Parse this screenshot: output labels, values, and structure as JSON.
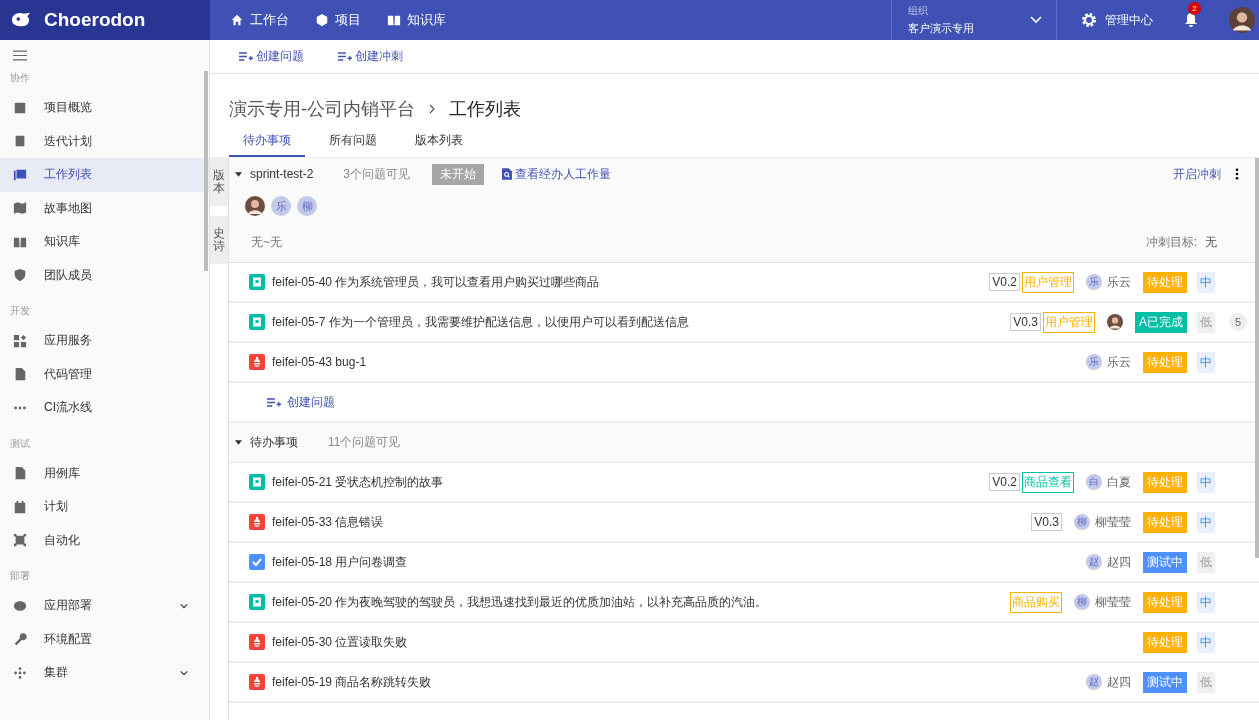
{
  "topbar": {
    "logo": "Choerodon",
    "nav": [
      "工作台",
      "项目",
      "知识库"
    ],
    "org_label": "组织",
    "org_value": "客户演示专用",
    "admin": "管理中心",
    "notifications": "2"
  },
  "sidebar": {
    "sections": [
      {
        "title": "协作",
        "items": [
          {
            "label": "项目概览",
            "selected": false,
            "expandable": false
          },
          {
            "label": "迭代计划",
            "selected": false,
            "expandable": false
          },
          {
            "label": "工作列表",
            "selected": true,
            "expandable": false
          },
          {
            "label": "故事地图",
            "selected": false,
            "expandable": false
          },
          {
            "label": "知识库",
            "selected": false,
            "expandable": false
          },
          {
            "label": "团队成员",
            "selected": false,
            "expandable": false
          }
        ]
      },
      {
        "title": "开发",
        "items": [
          {
            "label": "应用服务",
            "selected": false,
            "expandable": false
          },
          {
            "label": "代码管理",
            "selected": false,
            "expandable": false
          },
          {
            "label": "CI流水线",
            "selected": false,
            "expandable": false
          }
        ]
      },
      {
        "title": "测试",
        "items": [
          {
            "label": "用例库",
            "selected": false,
            "expandable": false
          },
          {
            "label": "计划",
            "selected": false,
            "expandable": false
          },
          {
            "label": "自动化",
            "selected": false,
            "expandable": false
          }
        ]
      },
      {
        "title": "部署",
        "items": [
          {
            "label": "应用部署",
            "selected": false,
            "expandable": true
          },
          {
            "label": "环境配置",
            "selected": false,
            "expandable": false
          },
          {
            "label": "集群",
            "selected": false,
            "expandable": true
          }
        ]
      }
    ]
  },
  "toolbar": [
    "创建问题",
    "创建冲刺"
  ],
  "breadcrumb": [
    "演示专用-公司内销平台",
    "工作列表"
  ],
  "tabs": [
    {
      "label": "待办事项",
      "selected": true
    },
    {
      "label": "所有问题",
      "selected": false
    },
    {
      "label": "版本列表",
      "selected": false
    }
  ],
  "side_tabs": [
    "版本",
    "史诗"
  ],
  "sprint": {
    "name": "sprint-test-2",
    "expanded": true,
    "count": "3个问题可见",
    "status": "未开始",
    "workload": "查看经办人工作量",
    "start": "开启冲刺",
    "members": [
      {
        "kind": "photo"
      },
      {
        "kind": "letter",
        "text": "乐"
      },
      {
        "kind": "letter",
        "text": "柳"
      }
    ],
    "dates": "无~无",
    "goal_label": "冲刺目标:",
    "goal": "无",
    "issues": [
      {
        "kind": "story",
        "key": "feifei-05-40",
        "summary": "作为系统管理员，我可以查看用户购买过哪些商品",
        "version": "V0.2",
        "epic": {
          "text": "用户管理",
          "color": "#ffb100"
        },
        "assignee": {
          "kind": "letter",
          "initial": "乐",
          "name": "乐云"
        },
        "status": {
          "text": "待处理",
          "color": "#ffb100"
        },
        "priority": {
          "text": "中",
          "kind": "medium"
        }
      },
      {
        "kind": "story",
        "key": "feifei-05-7",
        "summary": "作为一个管理员，我需要维护配送信息，以便用户可以看到配送信息",
        "version": "V0.3",
        "epic": {
          "text": "用户管理",
          "color": "#ffb100"
        },
        "assignee": {
          "kind": "photo"
        },
        "status": {
          "text": "A已完成",
          "color": "#00bfa5"
        },
        "priority": {
          "text": "低",
          "kind": "low"
        },
        "points": "5"
      },
      {
        "kind": "bug",
        "key": "feifei-05-43",
        "summary": "bug-1",
        "assignee": {
          "kind": "letter",
          "initial": "乐",
          "name": "乐云"
        },
        "status": {
          "text": "待处理",
          "color": "#ffb100"
        },
        "priority": {
          "text": "中",
          "kind": "medium"
        }
      }
    ],
    "create": "创建问题"
  },
  "backlog": {
    "name": "待办事项",
    "expanded": true,
    "count": "11个问题可见",
    "issues": [
      {
        "kind": "story",
        "key": "feifei-05-21",
        "summary": "受状态机控制的故事",
        "version": "V0.2",
        "epic": {
          "text": "商品查看",
          "color": "#00bfa5"
        },
        "assignee": {
          "kind": "letter",
          "initial": "白",
          "name": "白夏"
        },
        "status": {
          "text": "待处理",
          "color": "#ffb100"
        },
        "priority": {
          "text": "中",
          "kind": "medium"
        }
      },
      {
        "kind": "bug",
        "key": "feifei-05-33",
        "summary": "信息错误",
        "version": "V0.3",
        "assignee": {
          "kind": "letter",
          "initial": "柳",
          "name": "柳莹莹"
        },
        "status": {
          "text": "待处理",
          "color": "#ffb100"
        },
        "priority": {
          "text": "中",
          "kind": "medium"
        }
      },
      {
        "kind": "task",
        "key": "feifei-05-18",
        "summary": "用户问卷调查",
        "assignee": {
          "kind": "letter",
          "initial": "赵",
          "name": "赵四"
        },
        "status": {
          "text": "测试中",
          "color": "#4d90fe"
        },
        "priority": {
          "text": "低",
          "kind": "low"
        }
      },
      {
        "kind": "story",
        "key": "feifei-05-20",
        "summary": "作为夜晚驾驶的驾驶员，我想迅速找到最近的优质加油站，以补充高品质的汽油。",
        "epic": {
          "text": "商品购买",
          "color": "#ffb100"
        },
        "assignee": {
          "kind": "letter",
          "initial": "柳",
          "name": "柳莹莹"
        },
        "status": {
          "text": "待处理",
          "color": "#ffb100"
        },
        "priority": {
          "text": "中",
          "kind": "medium"
        }
      },
      {
        "kind": "bug",
        "key": "feifei-05-30",
        "summary": "位置读取失败",
        "status": {
          "text": "待处理",
          "color": "#ffb100"
        },
        "priority": {
          "text": "中",
          "kind": "medium"
        }
      },
      {
        "kind": "bug",
        "key": "feifei-05-19",
        "summary": "商品名称跳转失败",
        "assignee": {
          "kind": "letter",
          "initial": "赵",
          "name": "赵四"
        },
        "status": {
          "text": "测试中",
          "color": "#4d90fe"
        },
        "priority": {
          "text": "低",
          "kind": "low"
        }
      }
    ]
  }
}
